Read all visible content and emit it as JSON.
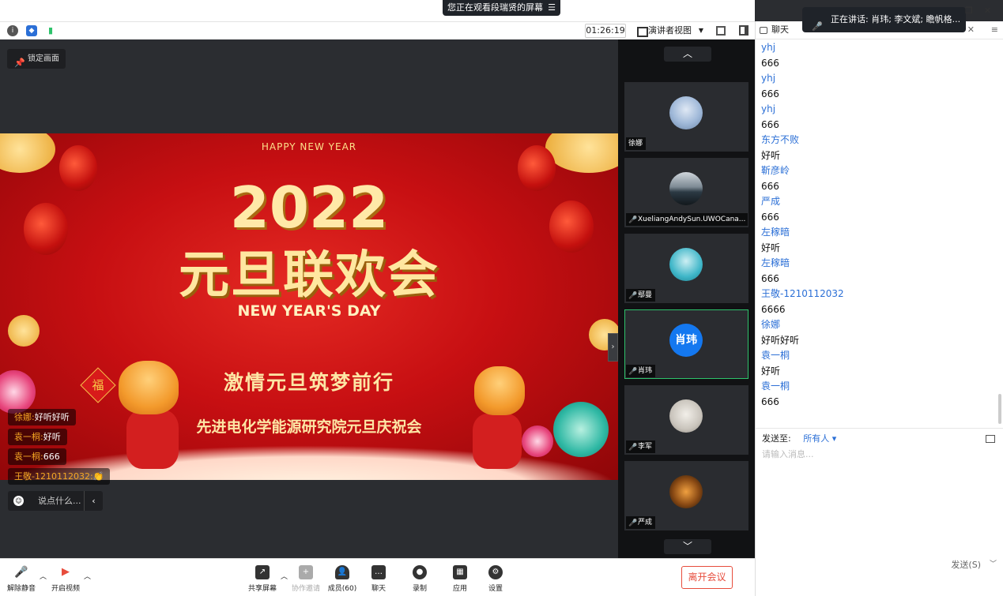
{
  "share_banner": {
    "text": "您正在观看段瑞贤的屏幕",
    "menu_icon": "menu-icon"
  },
  "toolbar": {
    "timer": "01:26:19",
    "view_label": "演讲者视图",
    "icons": [
      "info-icon",
      "shield-icon",
      "signal-icon",
      "fullscreen-icon",
      "sidebar-toggle-icon"
    ]
  },
  "stage": {
    "lock_label": "锁定画面",
    "slide": {
      "happy": "HAPPY NEW YEAR",
      "year": "2022",
      "title": "元旦联欢会",
      "subtitle": "NEW YEAR'S DAY",
      "motto": "激情元旦筑梦前行",
      "institute": "先进电化学能源研究院元旦庆祝会",
      "fu": "福"
    }
  },
  "danmaku": [
    {
      "name": "徐娜:",
      "text": "好听好听"
    },
    {
      "name": "袁一桐:",
      "text": "好听"
    },
    {
      "name": "袁一桐:",
      "text": "666"
    },
    {
      "name": "王敬-1210112032:",
      "text": "👏"
    }
  ],
  "say_placeholder": "说点什么...",
  "participants": [
    {
      "name": "徐娜",
      "muted": false,
      "avatar_color": "#9fb8d8"
    },
    {
      "name": "XueliangAndySun.UWOCana...",
      "muted": true,
      "avatar_color": "#2c3a44"
    },
    {
      "name": "鄢曼",
      "muted": true,
      "avatar_color": "#3fb6c8"
    },
    {
      "name": "肖玮",
      "muted": false,
      "speaking": true,
      "avatar_text": "肖玮",
      "avatar_color": "#1478f0"
    },
    {
      "name": "李军",
      "muted": true,
      "avatar_color": "#c9c4bc"
    },
    {
      "name": "严成",
      "muted": true,
      "avatar_color": "#8a4a14"
    }
  ],
  "bottombar": {
    "unmute": "解除静音",
    "start_video": "开启视频",
    "share": "共享屏幕",
    "invite": "协作邀请",
    "members": "成员(60)",
    "chat": "聊天",
    "record": "录制",
    "apps": "应用",
    "settings": "设置",
    "leave": "离开会议"
  },
  "chat": {
    "title": "聊天",
    "talking": "正在讲话: 肖玮; 李文斌; 瞻帆格...",
    "messages": [
      {
        "sender": "yhj",
        "text": "666"
      },
      {
        "sender": "yhj",
        "text": "666"
      },
      {
        "sender": "yhj",
        "text": "666"
      },
      {
        "sender": "东方不败",
        "text": "好听"
      },
      {
        "sender": "靳彦岭",
        "text": "666"
      },
      {
        "sender": "严成",
        "text": "666"
      },
      {
        "sender": "左稼暗",
        "text": "好听"
      },
      {
        "sender": "左稼暗",
        "text": "666"
      },
      {
        "sender": "王敬-1210112032",
        "text": "6666"
      },
      {
        "sender": "徐娜",
        "text": "好听好听"
      },
      {
        "sender": "袁一桐",
        "text": "好听"
      },
      {
        "sender": "袁一桐",
        "text": "666"
      }
    ],
    "send_to_label": "发送至:",
    "send_to_value": "所有人",
    "input_placeholder": "请输入消息...",
    "send_label": "发送(S)"
  },
  "window": {
    "buttons": [
      "restore-icon",
      "close-icon"
    ]
  }
}
